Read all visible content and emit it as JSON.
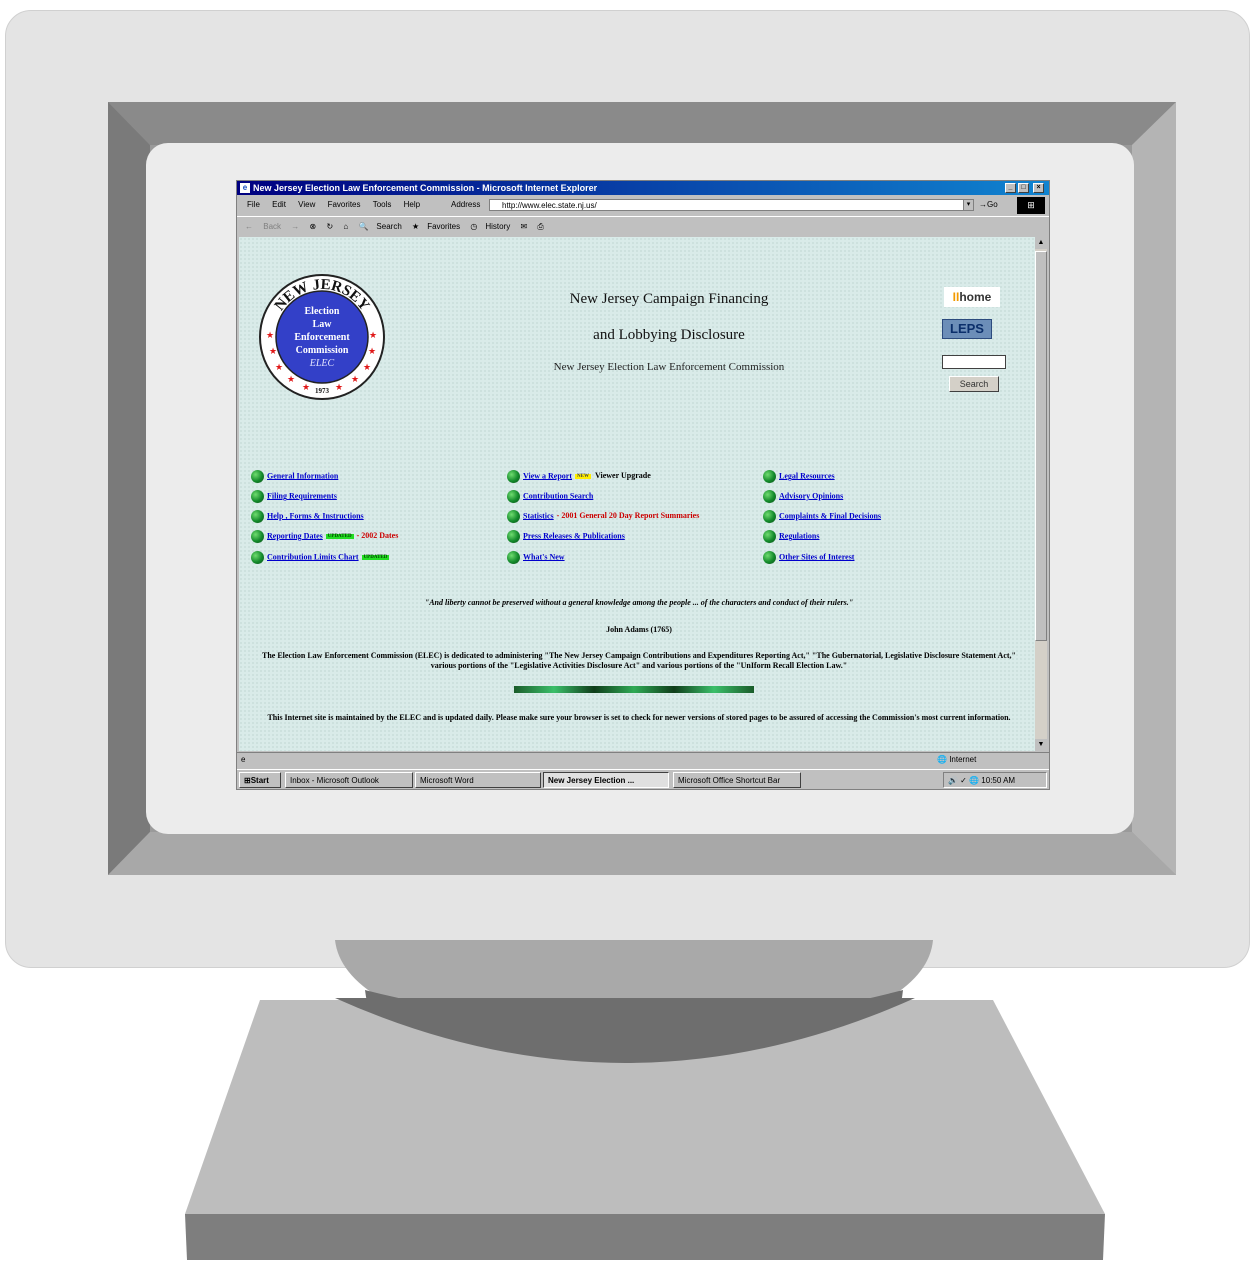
{
  "window": {
    "title": "New Jersey Election Law Enforcement Commission - Microsoft Internet Explorer"
  },
  "menu": [
    "File",
    "Edit",
    "View",
    "Favorites",
    "Tools",
    "Help"
  ],
  "address": {
    "label": "Address",
    "url": "http://www.elec.state.nj.us/",
    "go_label": "Go"
  },
  "toolbar": {
    "back": "Back",
    "forward": "Forward",
    "search": "Search",
    "favorites": "Favorites",
    "history": "History"
  },
  "page": {
    "seal": {
      "arc_text": "NEW JERSEY",
      "lines": [
        "Election",
        "Law",
        "Enforcement",
        "Commission"
      ],
      "monogram": "ELEC",
      "year": "1973"
    },
    "heading_line1": "New Jersey Campaign Financing",
    "heading_line2": "and Lobbying Disclosure",
    "subheading": "New Jersey Election Law Enforcement Commission",
    "home_logo_prefix": "II",
    "home_logo": "home",
    "leps_logo": "LEPS",
    "search_button": "Search",
    "links_col1": [
      {
        "label": "General Information"
      },
      {
        "label": "Filing Requirements"
      },
      {
        "label": "Help , Forms & Instructions"
      },
      {
        "label": "Reporting Dates",
        "badge": "UPDATED",
        "note": "- 2002 Dates"
      },
      {
        "label": "Contribution Limits Chart",
        "badge": "UPDATED"
      }
    ],
    "links_col2": [
      {
        "label": "View a Report",
        "badge": "NEW",
        "note": "Viewer Upgrade"
      },
      {
        "label": "Contribution Search"
      },
      {
        "label": "Statistics",
        "note": "- 2001 General 20 Day Report Summaries"
      },
      {
        "label": "Press Releases & Publications"
      },
      {
        "label": "What's New"
      }
    ],
    "links_col3": [
      {
        "label": "Legal Resources"
      },
      {
        "label": "Advisory Opinions"
      },
      {
        "label": "Complaints & Final Decisions"
      },
      {
        "label": "Regulations"
      },
      {
        "label": "Other Sites of Interest"
      }
    ],
    "quote": "\"And liberty cannot be preserved without a general knowledge among the people ... of the characters and conduct of their rulers.\"",
    "quote_author": "John Adams (1765)",
    "mission": "The Election Law Enforcement Commission (ELEC) is dedicated to administering \"The New Jersey Campaign Contributions and Expenditures Reporting Act,\" \"The Gubernatorial, Legislative Disclosure Statement Act,\" various portions of the \"Legislative Activities Disclosure Act\" and various portions of the \"UnIform Recall Election Law.\"",
    "footer": "This Internet site is maintained by the ELEC and is updated daily. Please make sure your browser is set to check for newer versions of stored pages to be assured of accessing the Commission's most current information."
  },
  "status": {
    "zone": "Internet"
  },
  "taskbar": {
    "start": "Start",
    "tasks": [
      "Inbox - Microsoft Outlook",
      "Microsoft Word",
      "New Jersey Election ...",
      "Microsoft Office Shortcut Bar"
    ],
    "clock": "10:50 AM"
  },
  "colors": {
    "page_background": "#d9ebe9",
    "link": "#0000cc",
    "note_red": "#cc0000",
    "titlebar": "#000080",
    "seal_blue": "#3340c8"
  }
}
